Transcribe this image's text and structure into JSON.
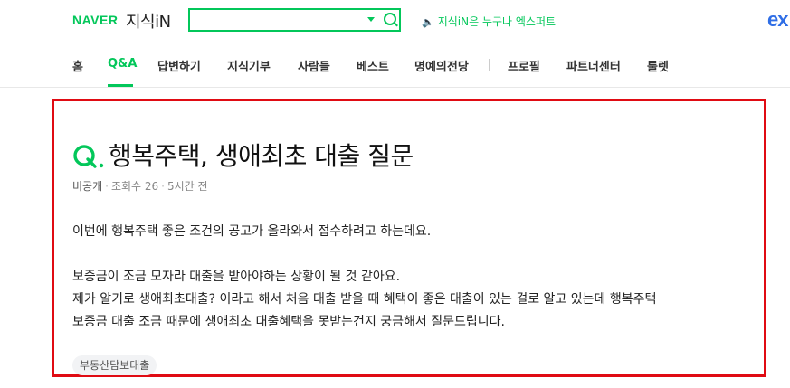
{
  "header": {
    "naver_logo": "NAVER",
    "kin_logo": "지식iN",
    "search": {
      "value": "",
      "placeholder": ""
    },
    "promo_text": "지식iN은 누구나 엑스퍼트",
    "expert_logo": "ex"
  },
  "nav": {
    "items": [
      {
        "label": "홈"
      },
      {
        "label": "Q&A"
      },
      {
        "label": "답변하기"
      },
      {
        "label": "지식기부"
      },
      {
        "label": "사람들"
      },
      {
        "label": "베스트"
      },
      {
        "label": "명예의전당"
      },
      {
        "label": "프로필"
      },
      {
        "label": "파트너센터"
      },
      {
        "label": "룰렛"
      }
    ],
    "active": "Q&A"
  },
  "question": {
    "title": "행복주택, 생애최초 대출 질문",
    "owner": "비공개",
    "views": "조회수 26",
    "time": "5시간 전",
    "body": [
      "이번에 행복주택 좋은 조건의 공고가 올라와서 접수하려고 하는데요.",
      "",
      "보증금이 조금 모자라 대출을 받아야하는 상황이 될 것 같아요.",
      "제가 알기로 생애최초대출? 이라고 해서 처음 대출 받을 때 혜택이 좋은 대출이 있는 걸로 알고 있는데 행복주택",
      "보증금 대출 조금 때문에 생애최초 대출혜택을 못받는건지 궁금해서 질문드립니다."
    ],
    "tag": "부동산담보대출"
  },
  "colors": {
    "brand_green": "#03c75a",
    "highlight_red": "#e00b13",
    "expert_blue": "#2f6ee6"
  }
}
